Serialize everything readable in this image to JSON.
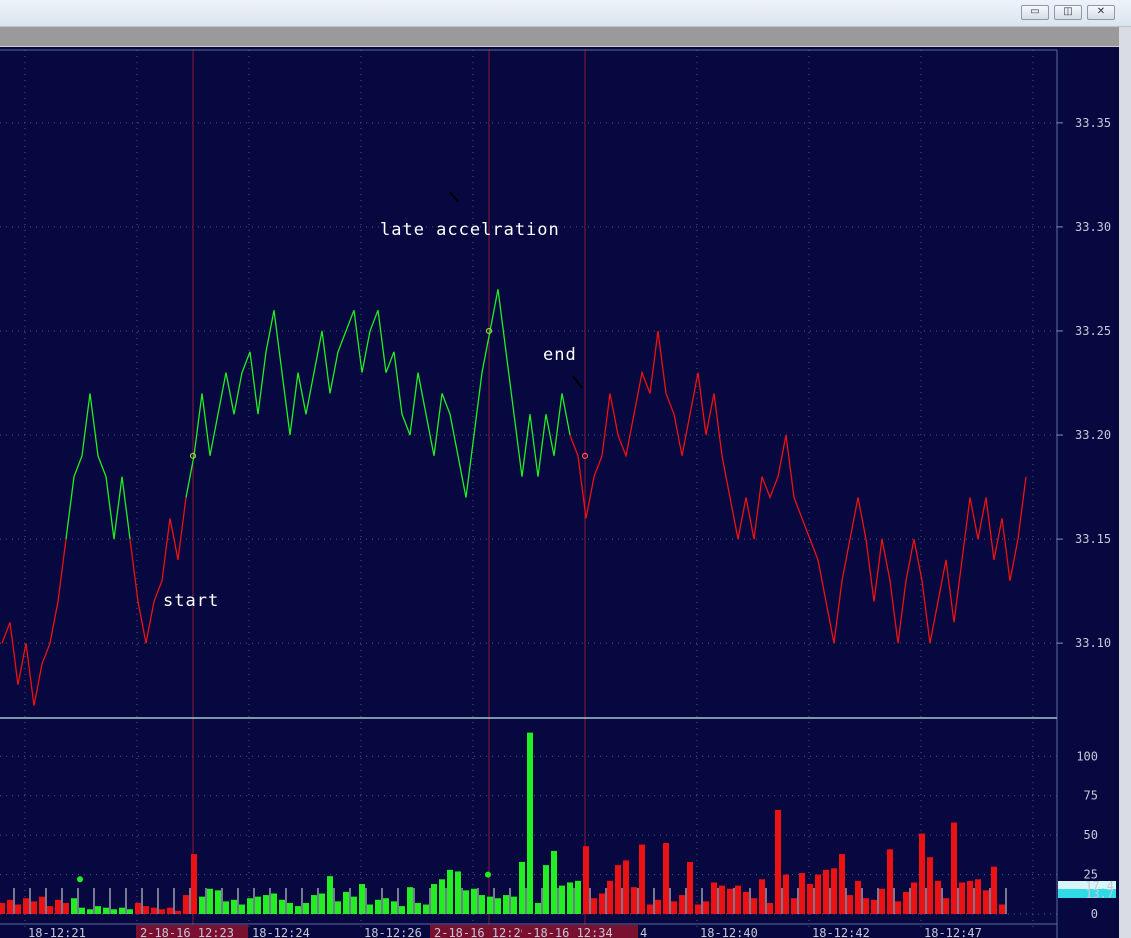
{
  "window": {
    "buttons": {
      "minimize": "▭",
      "restore": "◫",
      "close": "✕"
    }
  },
  "colors": {
    "background": "#06083f",
    "up": "#22ee22",
    "down": "#ee1111",
    "grid": "#55587a",
    "marker_line": "#8a1a3a",
    "divider": "#9fc6d0"
  },
  "chart_data": {
    "type": "line",
    "price_axis": {
      "ticks": [
        "33.35",
        "33.30",
        "33.25",
        "33.20",
        "33.15",
        "33.10"
      ],
      "range": [
        33.065,
        33.385
      ]
    },
    "volume_axis": {
      "ticks": [
        "100",
        "75",
        "50",
        "25",
        "0"
      ],
      "range": [
        0,
        123
      ]
    },
    "time_labels": [
      "18-12:21",
      "2-18-16 12:23",
      "18-12:24",
      "18-12:26",
      "2-18-16 12:29",
      "-18-16 12:34",
      "4",
      "18-12:40",
      "18-12:42",
      "18-12:47"
    ],
    "readouts": [
      "17.4",
      "13.7"
    ],
    "annotations": [
      "start",
      "late accelration",
      "end"
    ],
    "series": [
      {
        "color": "down",
        "values": [
          33.1,
          33.11,
          33.08,
          33.1,
          33.07,
          33.09,
          33.1,
          33.12,
          33.15
        ]
      },
      {
        "color": "up",
        "values": [
          33.15,
          33.18,
          33.19,
          33.22,
          33.19,
          33.18,
          33.15,
          33.18,
          33.15
        ]
      },
      {
        "color": "down",
        "values": [
          33.15,
          33.12,
          33.1,
          33.12,
          33.13,
          33.16,
          33.14,
          33.17
        ]
      },
      {
        "color": "up",
        "values": [
          33.17,
          33.19,
          33.22,
          33.19,
          33.21,
          33.23,
          33.21,
          33.23,
          33.24,
          33.21,
          33.24,
          33.26,
          33.23,
          33.2,
          33.23,
          33.21,
          33.23,
          33.25,
          33.22,
          33.24,
          33.25,
          33.26,
          33.23,
          33.25,
          33.26,
          33.23,
          33.24,
          33.21,
          33.2,
          33.23,
          33.21,
          33.19,
          33.22,
          33.21,
          33.19,
          33.17,
          33.2,
          33.23,
          33.25,
          33.27,
          33.24,
          33.21,
          33.18,
          33.21,
          33.18,
          33.21,
          33.19,
          33.22,
          33.2
        ]
      },
      {
        "color": "down",
        "values": [
          33.2,
          33.19,
          33.16,
          33.18,
          33.19,
          33.22,
          33.2,
          33.19,
          33.21,
          33.23,
          33.22,
          33.25,
          33.22,
          33.21,
          33.19,
          33.21,
          33.23,
          33.2,
          33.22,
          33.19,
          33.17,
          33.15,
          33.17,
          33.15,
          33.18,
          33.17,
          33.18,
          33.2,
          33.17,
          33.16,
          33.15,
          33.14,
          33.12,
          33.1,
          33.13,
          33.15,
          33.17,
          33.15,
          33.12,
          33.15,
          33.13,
          33.1,
          33.13,
          33.15,
          33.13,
          33.1,
          33.12,
          33.14,
          33.11,
          33.14,
          33.17,
          33.15,
          33.17,
          33.14,
          33.16,
          33.13,
          33.15,
          33.18
        ]
      }
    ],
    "volume": [
      {
        "v": 7,
        "c": "d"
      },
      {
        "v": 9,
        "c": "d"
      },
      {
        "v": 6,
        "c": "d"
      },
      {
        "v": 10,
        "c": "d"
      },
      {
        "v": 8,
        "c": "d"
      },
      {
        "v": 11,
        "c": "d"
      },
      {
        "v": 5,
        "c": "d"
      },
      {
        "v": 9,
        "c": "d"
      },
      {
        "v": 7,
        "c": "d"
      },
      {
        "v": 10,
        "c": "u"
      },
      {
        "v": 4,
        "c": "u"
      },
      {
        "v": 3,
        "c": "u"
      },
      {
        "v": 5,
        "c": "u"
      },
      {
        "v": 4,
        "c": "u"
      },
      {
        "v": 3,
        "c": "u"
      },
      {
        "v": 4,
        "c": "u"
      },
      {
        "v": 3,
        "c": "u"
      },
      {
        "v": 7,
        "c": "d"
      },
      {
        "v": 5,
        "c": "d"
      },
      {
        "v": 4,
        "c": "d"
      },
      {
        "v": 3,
        "c": "d"
      },
      {
        "v": 4,
        "c": "d"
      },
      {
        "v": 2,
        "c": "d"
      },
      {
        "v": 12,
        "c": "d"
      },
      {
        "v": 38,
        "c": "d"
      },
      {
        "v": 11,
        "c": "u"
      },
      {
        "v": 16,
        "c": "u"
      },
      {
        "v": 15,
        "c": "u"
      },
      {
        "v": 8,
        "c": "u"
      },
      {
        "v": 9,
        "c": "u"
      },
      {
        "v": 6,
        "c": "u"
      },
      {
        "v": 10,
        "c": "u"
      },
      {
        "v": 11,
        "c": "u"
      },
      {
        "v": 12,
        "c": "u"
      },
      {
        "v": 13,
        "c": "u"
      },
      {
        "v": 9,
        "c": "u"
      },
      {
        "v": 7,
        "c": "u"
      },
      {
        "v": 5,
        "c": "u"
      },
      {
        "v": 7,
        "c": "u"
      },
      {
        "v": 12,
        "c": "u"
      },
      {
        "v": 13,
        "c": "u"
      },
      {
        "v": 24,
        "c": "u"
      },
      {
        "v": 8,
        "c": "u"
      },
      {
        "v": 14,
        "c": "u"
      },
      {
        "v": 11,
        "c": "u"
      },
      {
        "v": 19,
        "c": "u"
      },
      {
        "v": 6,
        "c": "u"
      },
      {
        "v": 9,
        "c": "u"
      },
      {
        "v": 10,
        "c": "u"
      },
      {
        "v": 8,
        "c": "u"
      },
      {
        "v": 5,
        "c": "u"
      },
      {
        "v": 17,
        "c": "u"
      },
      {
        "v": 7,
        "c": "u"
      },
      {
        "v": 6,
        "c": "u"
      },
      {
        "v": 19,
        "c": "u"
      },
      {
        "v": 22,
        "c": "u"
      },
      {
        "v": 28,
        "c": "u"
      },
      {
        "v": 27,
        "c": "u"
      },
      {
        "v": 15,
        "c": "u"
      },
      {
        "v": 16,
        "c": "u"
      },
      {
        "v": 12,
        "c": "u"
      },
      {
        "v": 11,
        "c": "u"
      },
      {
        "v": 10,
        "c": "u"
      },
      {
        "v": 12,
        "c": "u"
      },
      {
        "v": 11,
        "c": "u"
      },
      {
        "v": 33,
        "c": "u"
      },
      {
        "v": 115,
        "c": "u"
      },
      {
        "v": 7,
        "c": "u"
      },
      {
        "v": 31,
        "c": "u"
      },
      {
        "v": 40,
        "c": "u"
      },
      {
        "v": 18,
        "c": "u"
      },
      {
        "v": 20,
        "c": "u"
      },
      {
        "v": 21,
        "c": "u"
      },
      {
        "v": 43,
        "c": "d"
      },
      {
        "v": 10,
        "c": "d"
      },
      {
        "v": 13,
        "c": "d"
      },
      {
        "v": 21,
        "c": "d"
      },
      {
        "v": 31,
        "c": "d"
      },
      {
        "v": 34,
        "c": "d"
      },
      {
        "v": 17,
        "c": "d"
      },
      {
        "v": 44,
        "c": "d"
      },
      {
        "v": 6,
        "c": "d"
      },
      {
        "v": 9,
        "c": "d"
      },
      {
        "v": 45,
        "c": "d"
      },
      {
        "v": 8,
        "c": "d"
      },
      {
        "v": 12,
        "c": "d"
      },
      {
        "v": 33,
        "c": "d"
      },
      {
        "v": 6,
        "c": "d"
      },
      {
        "v": 8,
        "c": "d"
      },
      {
        "v": 20,
        "c": "d"
      },
      {
        "v": 18,
        "c": "d"
      },
      {
        "v": 16,
        "c": "d"
      },
      {
        "v": 18,
        "c": "d"
      },
      {
        "v": 14,
        "c": "d"
      },
      {
        "v": 10,
        "c": "d"
      },
      {
        "v": 22,
        "c": "d"
      },
      {
        "v": 7,
        "c": "d"
      },
      {
        "v": 66,
        "c": "d"
      },
      {
        "v": 25,
        "c": "d"
      },
      {
        "v": 10,
        "c": "d"
      },
      {
        "v": 26,
        "c": "d"
      },
      {
        "v": 19,
        "c": "d"
      },
      {
        "v": 25,
        "c": "d"
      },
      {
        "v": 28,
        "c": "d"
      },
      {
        "v": 29,
        "c": "d"
      },
      {
        "v": 38,
        "c": "d"
      },
      {
        "v": 12,
        "c": "d"
      },
      {
        "v": 21,
        "c": "d"
      },
      {
        "v": 10,
        "c": "d"
      },
      {
        "v": 9,
        "c": "d"
      },
      {
        "v": 16,
        "c": "d"
      },
      {
        "v": 41,
        "c": "d"
      },
      {
        "v": 8,
        "c": "d"
      },
      {
        "v": 14,
        "c": "d"
      },
      {
        "v": 20,
        "c": "d"
      },
      {
        "v": 51,
        "c": "d"
      },
      {
        "v": 36,
        "c": "d"
      },
      {
        "v": 21,
        "c": "d"
      },
      {
        "v": 10,
        "c": "d"
      },
      {
        "v": 58,
        "c": "d"
      },
      {
        "v": 20,
        "c": "d"
      },
      {
        "v": 21,
        "c": "d"
      },
      {
        "v": 22,
        "c": "d"
      },
      {
        "v": 15,
        "c": "d"
      },
      {
        "v": 30,
        "c": "d"
      },
      {
        "v": 6,
        "c": "d"
      }
    ]
  }
}
